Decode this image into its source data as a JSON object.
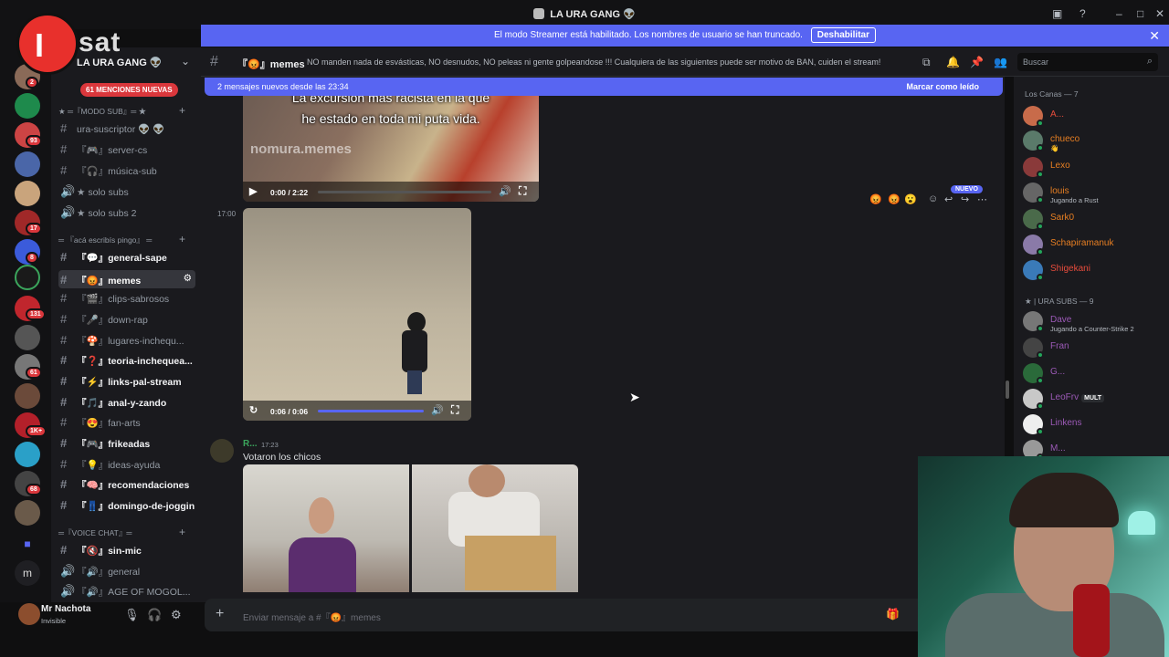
{
  "window": {
    "title": "LA URA GANG 👽"
  },
  "overlay_logo": {
    "letter": "I",
    "brand": "sat"
  },
  "banner": {
    "text": "El modo Streamer está habilitado. Los nombres de usuario se han truncado.",
    "button": "Deshabilitar"
  },
  "server": {
    "name": "LA URA GANG 👽",
    "mentions_pill": "61 MENCIONES NUEVAS"
  },
  "guild_badges": [
    "2",
    "93",
    "17",
    "8",
    "131",
    "61",
    "1K+",
    "68"
  ],
  "guild_letter": "m",
  "categories": [
    {
      "label": "★ ═『MODO SUB』═ ★"
    },
    {
      "label": "═ 『acá escribís pingo』 ═"
    },
    {
      "label": "═『VOICE CHAT』═"
    }
  ],
  "channels": [
    {
      "label": "ura-suscriptor 👽 👽",
      "icon": "#"
    },
    {
      "label": "『🎮』server-cs",
      "icon": "#"
    },
    {
      "label": "『🎧』música-sub",
      "icon": "#"
    },
    {
      "label": "★ solo subs",
      "icon": "🔊"
    },
    {
      "label": "★ solo subs 2",
      "icon": "🔊"
    },
    {
      "label": "『💬』general-sape",
      "icon": "#"
    },
    {
      "label": "『😡』memes",
      "icon": "#"
    },
    {
      "label": "『🎬』clips-sabrosos",
      "icon": "#"
    },
    {
      "label": "『🎤』down-rap",
      "icon": "#"
    },
    {
      "label": "『🍄』lugares-inchequ...",
      "icon": "#"
    },
    {
      "label": "『❓』teoria-inchequea...",
      "icon": "#"
    },
    {
      "label": "『⚡』links-pal-stream",
      "icon": "#"
    },
    {
      "label": "『🎵』anal-y-zando",
      "icon": "#"
    },
    {
      "label": "『😍』fan-arts",
      "icon": "#"
    },
    {
      "label": "『🎮』frikeadas",
      "icon": "#"
    },
    {
      "label": "『💡』ideas-ayuda",
      "icon": "#"
    },
    {
      "label": "『🧠』recomendaciones",
      "icon": "#"
    },
    {
      "label": "『👖』domingo-de-joggin",
      "icon": "#"
    },
    {
      "label": "『🔇』sin-mic",
      "icon": "#"
    },
    {
      "label": "『🔊』general",
      "icon": "🔊"
    },
    {
      "label": "『🔊』AGE OF MOGOL...",
      "icon": "🔊"
    }
  ],
  "user": {
    "name": "Mr Nachota",
    "status": "Invisible"
  },
  "header": {
    "channel": "『😡』memes",
    "topic": "NO manden nada de esvásticas, NO desnudos, NO peleas ni gente golpeandose !!! Cualquiera de las siguientes puede ser motivo de BAN, cuiden el stream!",
    "search_placeholder": "Buscar"
  },
  "new_messages": {
    "text": "2 mensajes nuevos desde las 23:34",
    "mark_read": "Marcar como leído"
  },
  "video1": {
    "caption_top": "La excursión más racista en la que",
    "caption_bottom": "he estado en toda mi puta vida.",
    "watermark": "nomura.memes",
    "time": "0:00 / 2:22",
    "progress": 0
  },
  "video2": {
    "timestamp": "17:00",
    "time": "0:06 / 0:06",
    "progress": 1
  },
  "nuevo_tag": "NUEVO",
  "message": {
    "author": "R...",
    "time": "17:23",
    "text": "Votaron los chicos"
  },
  "composer": {
    "placeholder": "Enviar mensaje a #『😡』memes"
  },
  "member_groups": [
    {
      "label": "Los Canas — 7",
      "members": [
        {
          "name": "A...",
          "color": "#e74c3c"
        },
        {
          "name": "chueco",
          "sub": "👋",
          "color": "#e67e22"
        },
        {
          "name": "Lexo",
          "color": "#e67e22"
        },
        {
          "name": "louis",
          "sub": "Jugando a Rust",
          "color": "#e67e22"
        },
        {
          "name": "Sark0",
          "color": "#e67e22"
        },
        {
          "name": "Schapiramanuk",
          "color": "#e67e22"
        },
        {
          "name": "Shigekani",
          "color": "#e74c3c"
        }
      ]
    },
    {
      "label": "★ | URA SUBS — 9",
      "members": [
        {
          "name": "Dave",
          "sub": "Jugando a Counter-Strike 2",
          "color": "#9b59b6"
        },
        {
          "name": "Fran",
          "color": "#9b59b6"
        },
        {
          "name": "G...",
          "color": "#9b59b6"
        },
        {
          "name": "LeoFrv",
          "badge": "MULT",
          "color": "#9b59b6"
        },
        {
          "name": "Linkens",
          "color": "#9b59b6"
        },
        {
          "name": "M...",
          "color": "#9b59b6"
        }
      ]
    }
  ]
}
